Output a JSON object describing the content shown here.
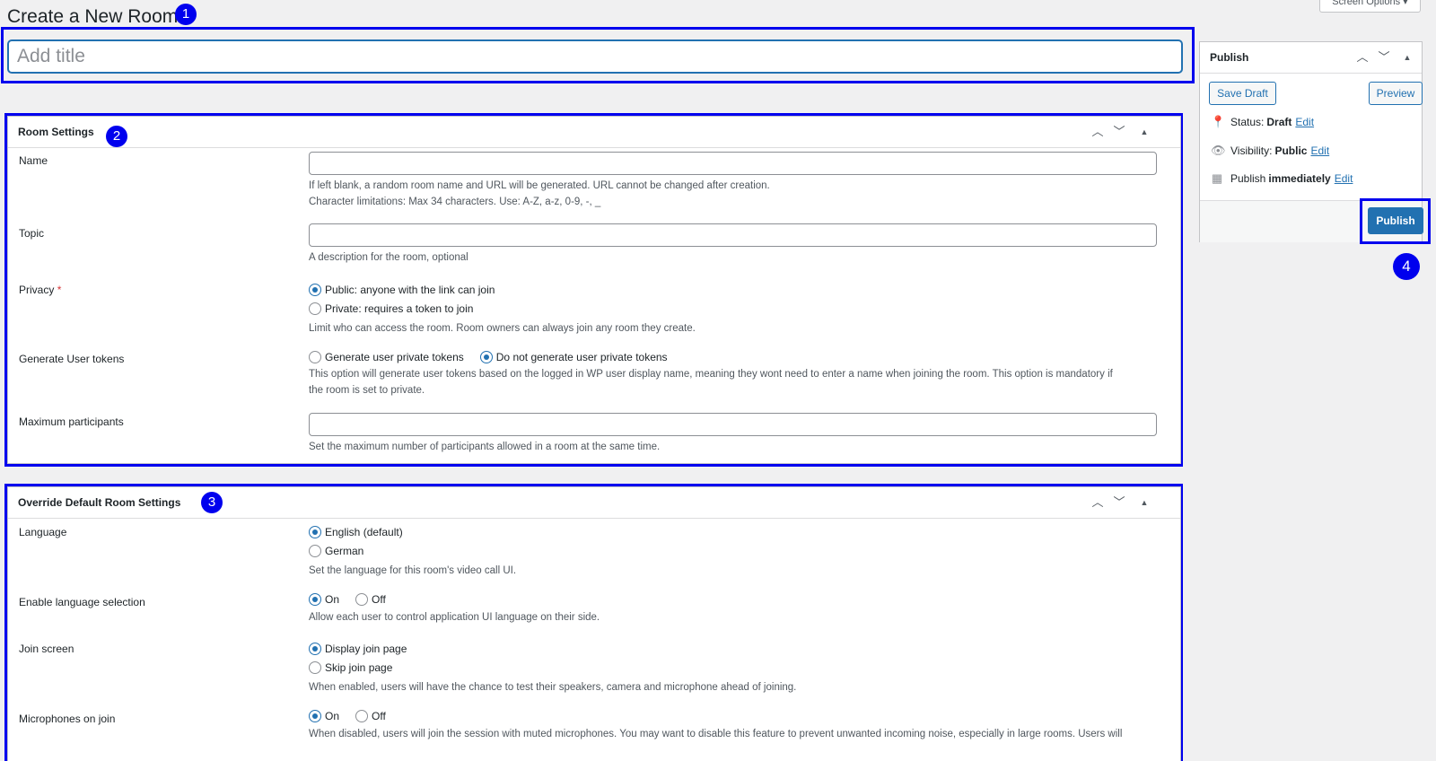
{
  "page": {
    "title": "Create a New Room",
    "screen_options": "Screen Options ▾"
  },
  "title_field": {
    "placeholder": "Add title",
    "value": ""
  },
  "callouts": [
    "1",
    "2",
    "3",
    "4"
  ],
  "room_settings": {
    "title": "Room Settings",
    "name": {
      "label": "Name",
      "value": "",
      "desc1": "If left blank, a random room name and URL will be generated. URL cannot be changed after creation.",
      "desc2": "Character limitations: Max 34 characters. Use: A-Z, a-z, 0-9, -, _"
    },
    "topic": {
      "label": "Topic",
      "value": "",
      "desc": "A description for the room, optional"
    },
    "privacy": {
      "label": "Privacy",
      "required_mark": "*",
      "options": [
        "Public: anyone with the link can join",
        "Private: requires a token to join"
      ],
      "selected": 0,
      "desc": "Limit who can access the room. Room owners can always join any room they create."
    },
    "user_tokens": {
      "label": "Generate User tokens",
      "options": [
        "Generate user private tokens",
        "Do not generate user private tokens"
      ],
      "selected": 1,
      "desc1": "This option will generate user tokens based on the logged in WP user display name, meaning they wont need to enter a name when joining the room. This option is mandatory if",
      "desc2": "the room is set to private."
    },
    "max_participants": {
      "label": "Maximum participants",
      "value": "",
      "desc": "Set the maximum number of participants allowed in a room at the same time."
    }
  },
  "override_settings": {
    "title": "Override Default Room Settings",
    "language": {
      "label": "Language",
      "options": [
        "English (default)",
        "German"
      ],
      "selected": 0,
      "desc": "Set the language for this room's video call UI."
    },
    "language_selection": {
      "label": "Enable language selection",
      "options": [
        "On",
        "Off"
      ],
      "selected": 0,
      "desc": "Allow each user to control application UI language on their side."
    },
    "join_screen": {
      "label": "Join screen",
      "options": [
        "Display join page",
        "Skip join page"
      ],
      "selected": 0,
      "desc": "When enabled, users will have the chance to test their speakers, camera and microphone ahead of joining."
    },
    "microphones": {
      "label": "Microphones on join",
      "options": [
        "On",
        "Off"
      ],
      "selected": 0,
      "desc": "When disabled, users will join the session with muted microphones. You may want to disable this feature to prevent unwanted incoming noise, especially in large rooms. Users will"
    }
  },
  "publish": {
    "title": "Publish",
    "save_draft": "Save Draft",
    "preview": "Preview",
    "status_label": "Status:",
    "status_value": "Draft",
    "visibility_label": "Visibility:",
    "visibility_value": "Public",
    "schedule_label": "Publish",
    "schedule_value": "immediately",
    "edit": "Edit",
    "publish_button": "Publish"
  },
  "colors": {
    "accent": "#2271b1",
    "highlight": "#0000ee",
    "background": "#f0f0f1"
  }
}
